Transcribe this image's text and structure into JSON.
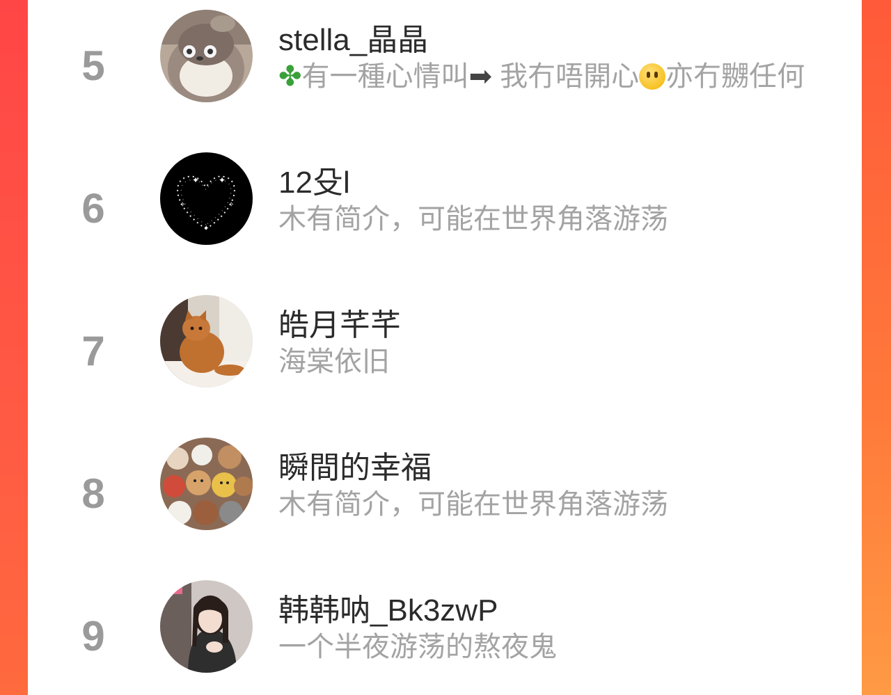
{
  "list": [
    {
      "rank": "5",
      "name": "stella_晶晶",
      "bio_prefix_icon": "four-leaf-clover-emoji",
      "bio_part1": "有一種心情叫",
      "bio_arrow_icon": "right-arrow-emoji",
      "bio_part2": "我冇唔開心",
      "bio_face_icon": "no-mouth-face-emoji",
      "bio_part3": "亦冇嬲任何",
      "avatar_icon": "plush-toy-avatar"
    },
    {
      "rank": "6",
      "name": "12殳l",
      "bio": "木有简介，可能在世界角落游荡",
      "avatar_icon": "sparkle-heart-avatar"
    },
    {
      "rank": "7",
      "name": "皓月芊芊",
      "bio": "海棠依旧",
      "avatar_icon": "orange-cat-avatar"
    },
    {
      "rank": "8",
      "name": "瞬間的幸福",
      "bio": "木有简介，可能在世界角落游荡",
      "avatar_icon": "teddy-bears-avatar"
    },
    {
      "rank": "9",
      "name": "韩韩呐_Bk3zwP",
      "bio": "一个半夜游荡的熬夜鬼",
      "avatar_icon": "girl-portrait-avatar"
    }
  ],
  "colors": {
    "rank": "#9a9a9a",
    "name": "#2b2b2b",
    "bio": "#a3a3a3",
    "background_gradient_start": "#ff4a4a",
    "background_gradient_end": "#ff8a3a"
  }
}
